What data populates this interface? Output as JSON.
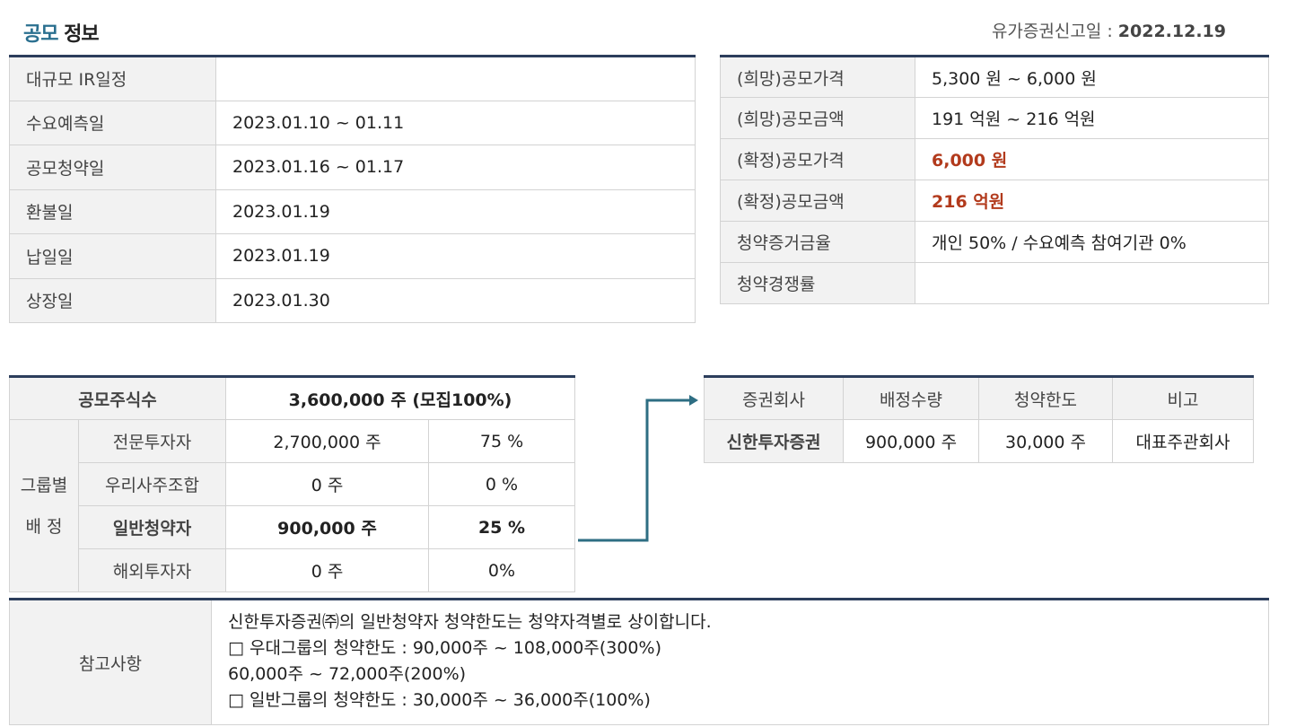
{
  "header": {
    "title_accent": "공모",
    "title_rest": "정보",
    "filing_label": "유가증권신고일 : ",
    "filing_date": "2022.12.19"
  },
  "schedule": [
    {
      "label": "대규모 IR일정",
      "value": ""
    },
    {
      "label": "수요예측일",
      "value": "2023.01.10 ~ 01.11"
    },
    {
      "label": "공모청약일",
      "value": "2023.01.16 ~ 01.17"
    },
    {
      "label": "환불일",
      "value": "2023.01.19"
    },
    {
      "label": "납일일",
      "value": "2023.01.19"
    },
    {
      "label": "상장일",
      "value": "2023.01.30"
    }
  ],
  "price": [
    {
      "label": "(희망)공모가격",
      "value": "5,300 원 ~ 6,000 원"
    },
    {
      "label": "(희망)공모금액",
      "value": "191 억원  ~ 216 억원"
    },
    {
      "label": "(확정)공모가격",
      "value": "6,000 원"
    },
    {
      "label": "(확정)공모금액",
      "value": "216 억원"
    },
    {
      "label": "청약증거금율",
      "value": "개인 50% / 수요예측 참여기관 0%"
    },
    {
      "label": "청약경쟁률",
      "value": ""
    }
  ],
  "allocation": {
    "total_label": "공모주식수",
    "total_value": "3,600,000 주 (모집100%)",
    "group_label_1": "그룹별",
    "group_label_2": "배 정",
    "rows": [
      {
        "name": "전문투자자",
        "shares": "2,700,000 주",
        "pct": "75 %"
      },
      {
        "name": "우리사주조합",
        "shares": "0 주",
        "pct": "0 %"
      },
      {
        "name": "일반청약자",
        "shares": "900,000 주",
        "pct": "25 %"
      },
      {
        "name": "해외투자자",
        "shares": "0 주",
        "pct": "0%"
      }
    ]
  },
  "underwriter": {
    "headers": [
      "증권회사",
      "배정수량",
      "청약한도",
      "비고"
    ],
    "row": {
      "company": "신한투자증권",
      "quantity": "900,000 주",
      "limit": "30,000 주",
      "note": "대표주관회사"
    }
  },
  "notes": {
    "label": "참고사항",
    "lines": [
      "신한투자증권㈜의 일반청약자 청약한도는 청약자격별로 상이합니다.",
      "□ 우대그룹의 청약한도 : 90,000주 ~ 108,000주(300%)",
      "60,000주 ~ 72,000주(200%)",
      "□ 일반그룹의 청약한도 : 30,000주 ~ 36,000주(100%)"
    ]
  },
  "colors": {
    "accent": "#2a6f8f",
    "table_top_border": "#2c3e5c",
    "confirmed_red": "#b23a1c",
    "label_bg": "#f2f2f2"
  }
}
